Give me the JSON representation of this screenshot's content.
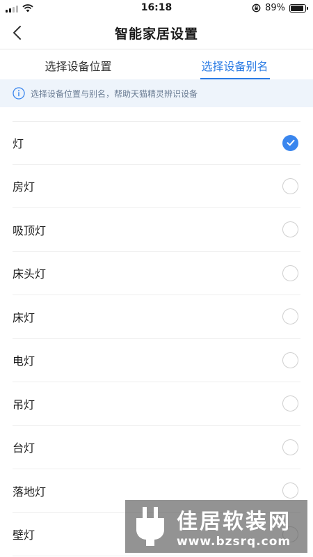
{
  "status_bar": {
    "time": "16:18",
    "battery_percent": "89%",
    "battery_level": 0.89,
    "icons": [
      "signal-icon",
      "wifi-icon",
      "orientation-lock-icon",
      "battery-icon"
    ]
  },
  "nav": {
    "title": "智能家居设置",
    "back_icon": "chevron-left-icon"
  },
  "tabs": [
    {
      "label": "选择设备位置",
      "active": false
    },
    {
      "label": "选择设备别名",
      "active": true
    }
  ],
  "hint": {
    "icon": "info-icon",
    "text": "选择设备位置与别名，帮助天猫精灵辨识设备"
  },
  "options": [
    {
      "label": "灯",
      "selected": true
    },
    {
      "label": "房灯",
      "selected": false
    },
    {
      "label": "吸顶灯",
      "selected": false
    },
    {
      "label": "床头灯",
      "selected": false
    },
    {
      "label": "床灯",
      "selected": false
    },
    {
      "label": "电灯",
      "selected": false
    },
    {
      "label": "吊灯",
      "selected": false
    },
    {
      "label": "台灯",
      "selected": false
    },
    {
      "label": "落地灯",
      "selected": false
    },
    {
      "label": "壁灯",
      "selected": false
    }
  ],
  "watermark": {
    "title": "佳居软装网",
    "url": "www.bzsrq.com"
  },
  "colors": {
    "accent": "#2a7be4",
    "check_fill": "#3a86ee",
    "hint_bg": "#eef4fb",
    "hint_text": "#6a7c93"
  }
}
